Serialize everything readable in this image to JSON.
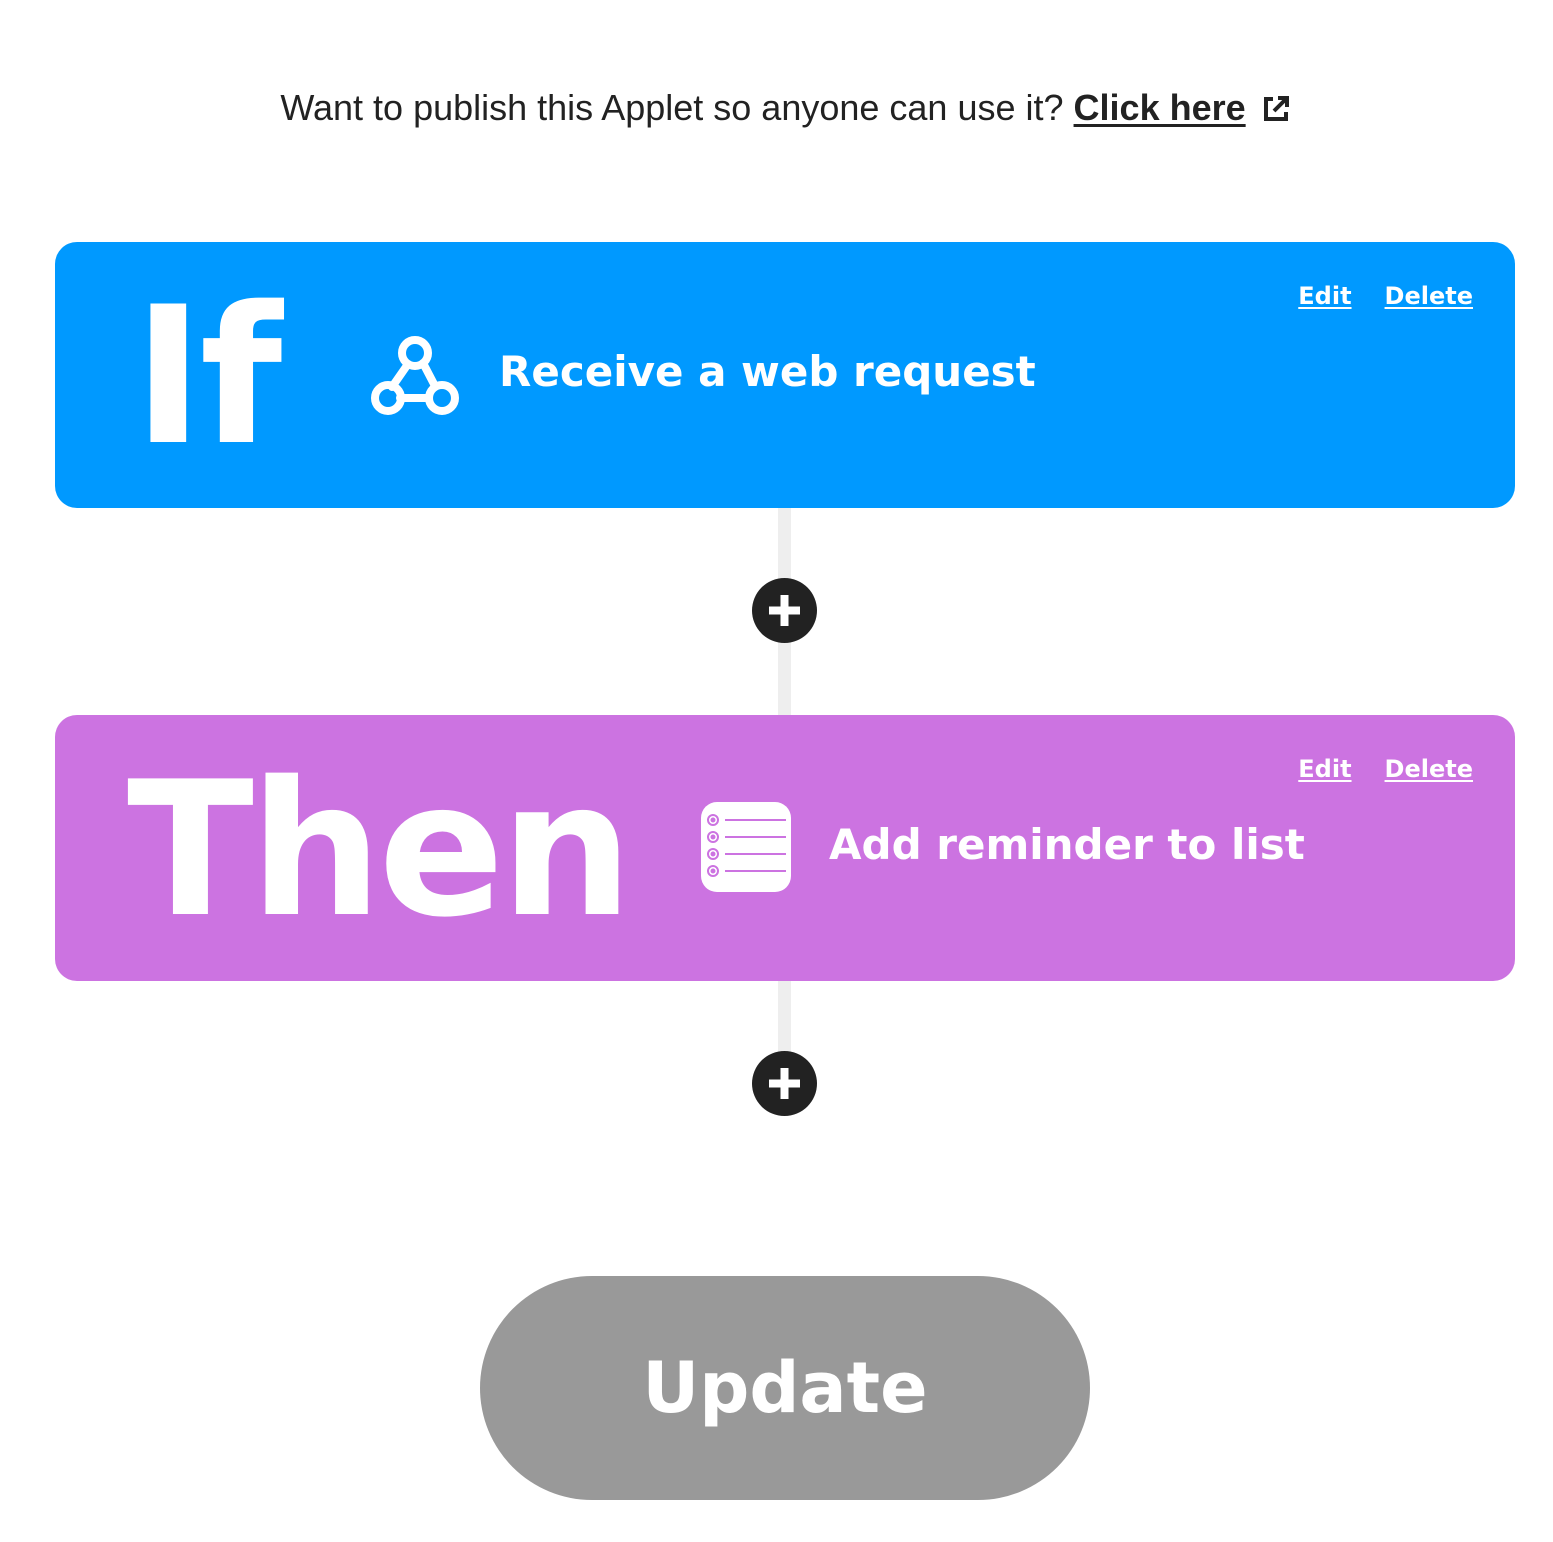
{
  "publish": {
    "prompt": "Want to publish this Applet so anyone can use it?",
    "link_label": "Click here",
    "link_icon": "external-link-icon"
  },
  "trigger": {
    "keyword": "If",
    "action": "Receive a web request",
    "service_icon": "webhooks-icon",
    "edit_label": "Edit",
    "delete_label": "Delete",
    "color": "#0099ff"
  },
  "action": {
    "keyword": "Then",
    "action": "Add reminder to list",
    "service_icon": "reminders-list-icon",
    "edit_label": "Edit",
    "delete_label": "Delete",
    "color": "#cc73e1"
  },
  "add_step_icon": "plus-icon",
  "update_button": {
    "label": "Update",
    "color": "#999999"
  }
}
